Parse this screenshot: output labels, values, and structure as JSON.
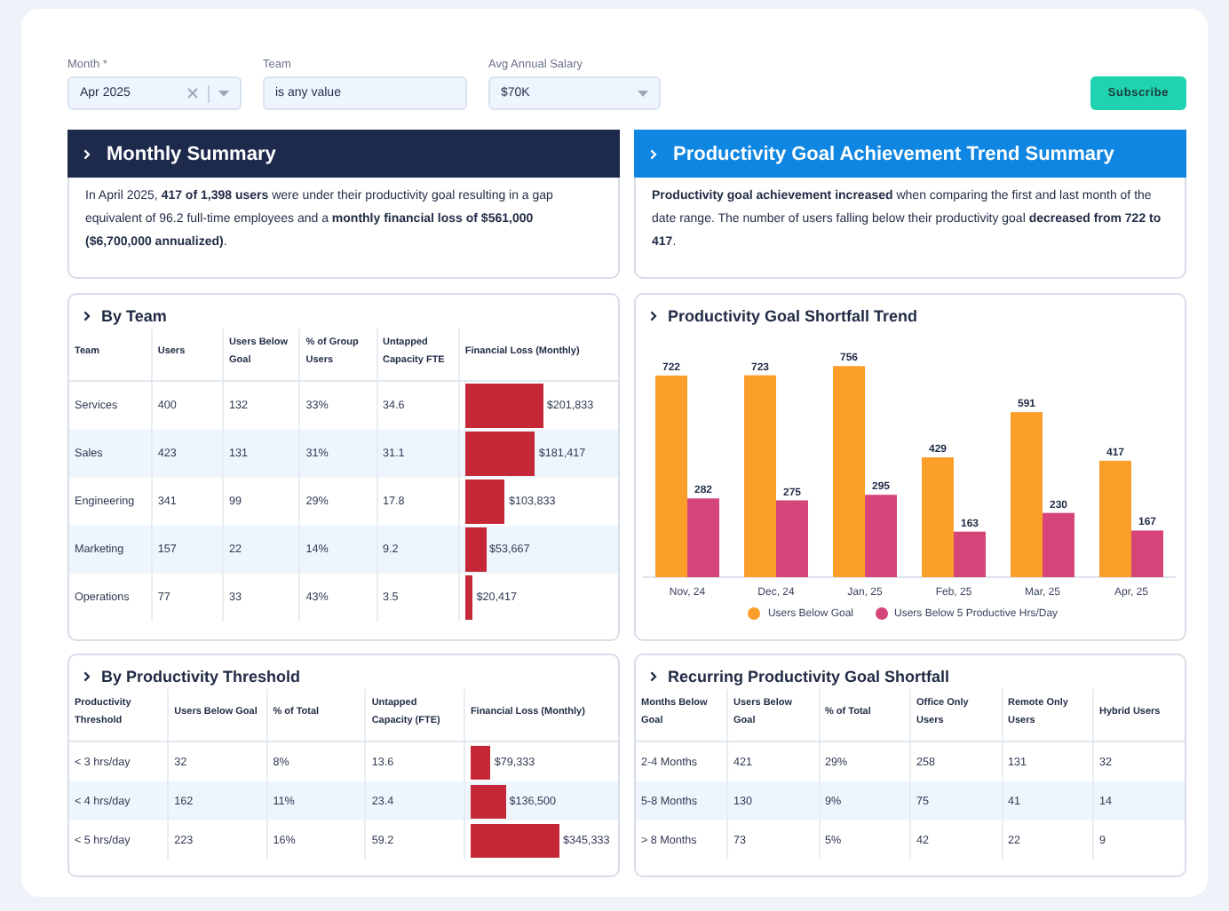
{
  "filters": [
    {
      "label": "Month *",
      "value": "Apr 2025",
      "kind": "clearable-select"
    },
    {
      "label": "Team",
      "value": "is any value",
      "kind": "text"
    },
    {
      "label": "Avg Annual Salary",
      "value": "$70K",
      "kind": "select"
    }
  ],
  "subscribe_button": "Subscribe",
  "summaries": [
    {
      "title": "Monthly Summary",
      "color": "#1e2a4c",
      "text": "In April 2025, **417 of 1,398 users** were under their productivity goal resulting in a gap equivalent of 96.2 full-time employees and a **monthly financial loss of $561,000 ($6,700,000 annualized)**."
    },
    {
      "title": "Productivity Goal Achievement Trend Summary",
      "color": "#0e86e2",
      "text": "**Productivity goal achievement increased** when comparing the first and last month of the date range. The number of users falling below their productivity goal **decreased from 722 to 417**."
    }
  ],
  "team_table": {
    "title": "By Team",
    "columns": [
      "Team",
      "Users",
      "Users Below Goal",
      "% of Group Users",
      "Untapped Capacity FTE",
      "Financial Loss (Monthly)"
    ],
    "rows": [
      {
        "cells": [
          "Services",
          "400",
          "132",
          "33%",
          "34.6"
        ],
        "loss": "$201,833"
      },
      {
        "cells": [
          "Sales",
          "423",
          "131",
          "31%",
          "31.1"
        ],
        "loss": "$181,417"
      },
      {
        "cells": [
          "Engineering",
          "341",
          "99",
          "29%",
          "17.8"
        ],
        "loss": "$103,833"
      },
      {
        "cells": [
          "Marketing",
          "157",
          "22",
          "14%",
          "9.2"
        ],
        "loss": "$53,667"
      },
      {
        "cells": [
          "Operations",
          "77",
          "33",
          "43%",
          "3.5"
        ],
        "loss": "$20,417"
      }
    ]
  },
  "trend": {
    "title": "Productivity Goal Shortfall Trend",
    "chart_data": {
      "type": "bar",
      "categories": [
        "Nov, 24",
        "Dec, 24",
        "Jan, 25",
        "Feb, 25",
        "Mar, 25",
        "Apr, 25"
      ],
      "legend": "bottom",
      "data_labels": true,
      "series": [
        {
          "name": "Users Below Goal",
          "color": "#fb9e2a",
          "values": [
            722,
            723,
            756,
            429,
            591,
            417
          ]
        },
        {
          "name": "Users Below 5 Productive Hrs/Day",
          "color": "#d6457a",
          "values": [
            282,
            275,
            295,
            163,
            230,
            167
          ]
        }
      ]
    }
  },
  "threshold_table": {
    "title": "By Productivity Threshold",
    "columns": [
      "Productivity Threshold",
      "Users Below Goal",
      "% of Total",
      "Untapped Capacity (FTE)",
      "Financial Loss (Monthly)"
    ],
    "rows": [
      {
        "cells": [
          "< 3 hrs/day",
          "32",
          "8%",
          "13.6"
        ],
        "loss": "$79,333"
      },
      {
        "cells": [
          "< 4 hrs/day",
          "162",
          "11%",
          "23.4"
        ],
        "loss": "$136,500"
      },
      {
        "cells": [
          "< 5 hrs/day",
          "223",
          "16%",
          "59.2"
        ],
        "loss": "$345,333"
      }
    ]
  },
  "recurring_table": {
    "title": "Recurring Productivity Goal Shortfall",
    "columns": [
      "Months Below Goal",
      "Users Below Goal",
      "% of Total",
      "Office Only Users",
      "Remote Only Users",
      "Hybrid Users"
    ],
    "rows": [
      {
        "cells": [
          "2-4 Months",
          "421",
          "29%",
          "258",
          "131",
          "32"
        ]
      },
      {
        "cells": [
          "5-8 Months",
          "130",
          "9%",
          "75",
          "41",
          "14"
        ]
      },
      {
        "cells": [
          "> 8 Months",
          "73",
          "5%",
          "42",
          "22",
          "9"
        ]
      }
    ]
  }
}
